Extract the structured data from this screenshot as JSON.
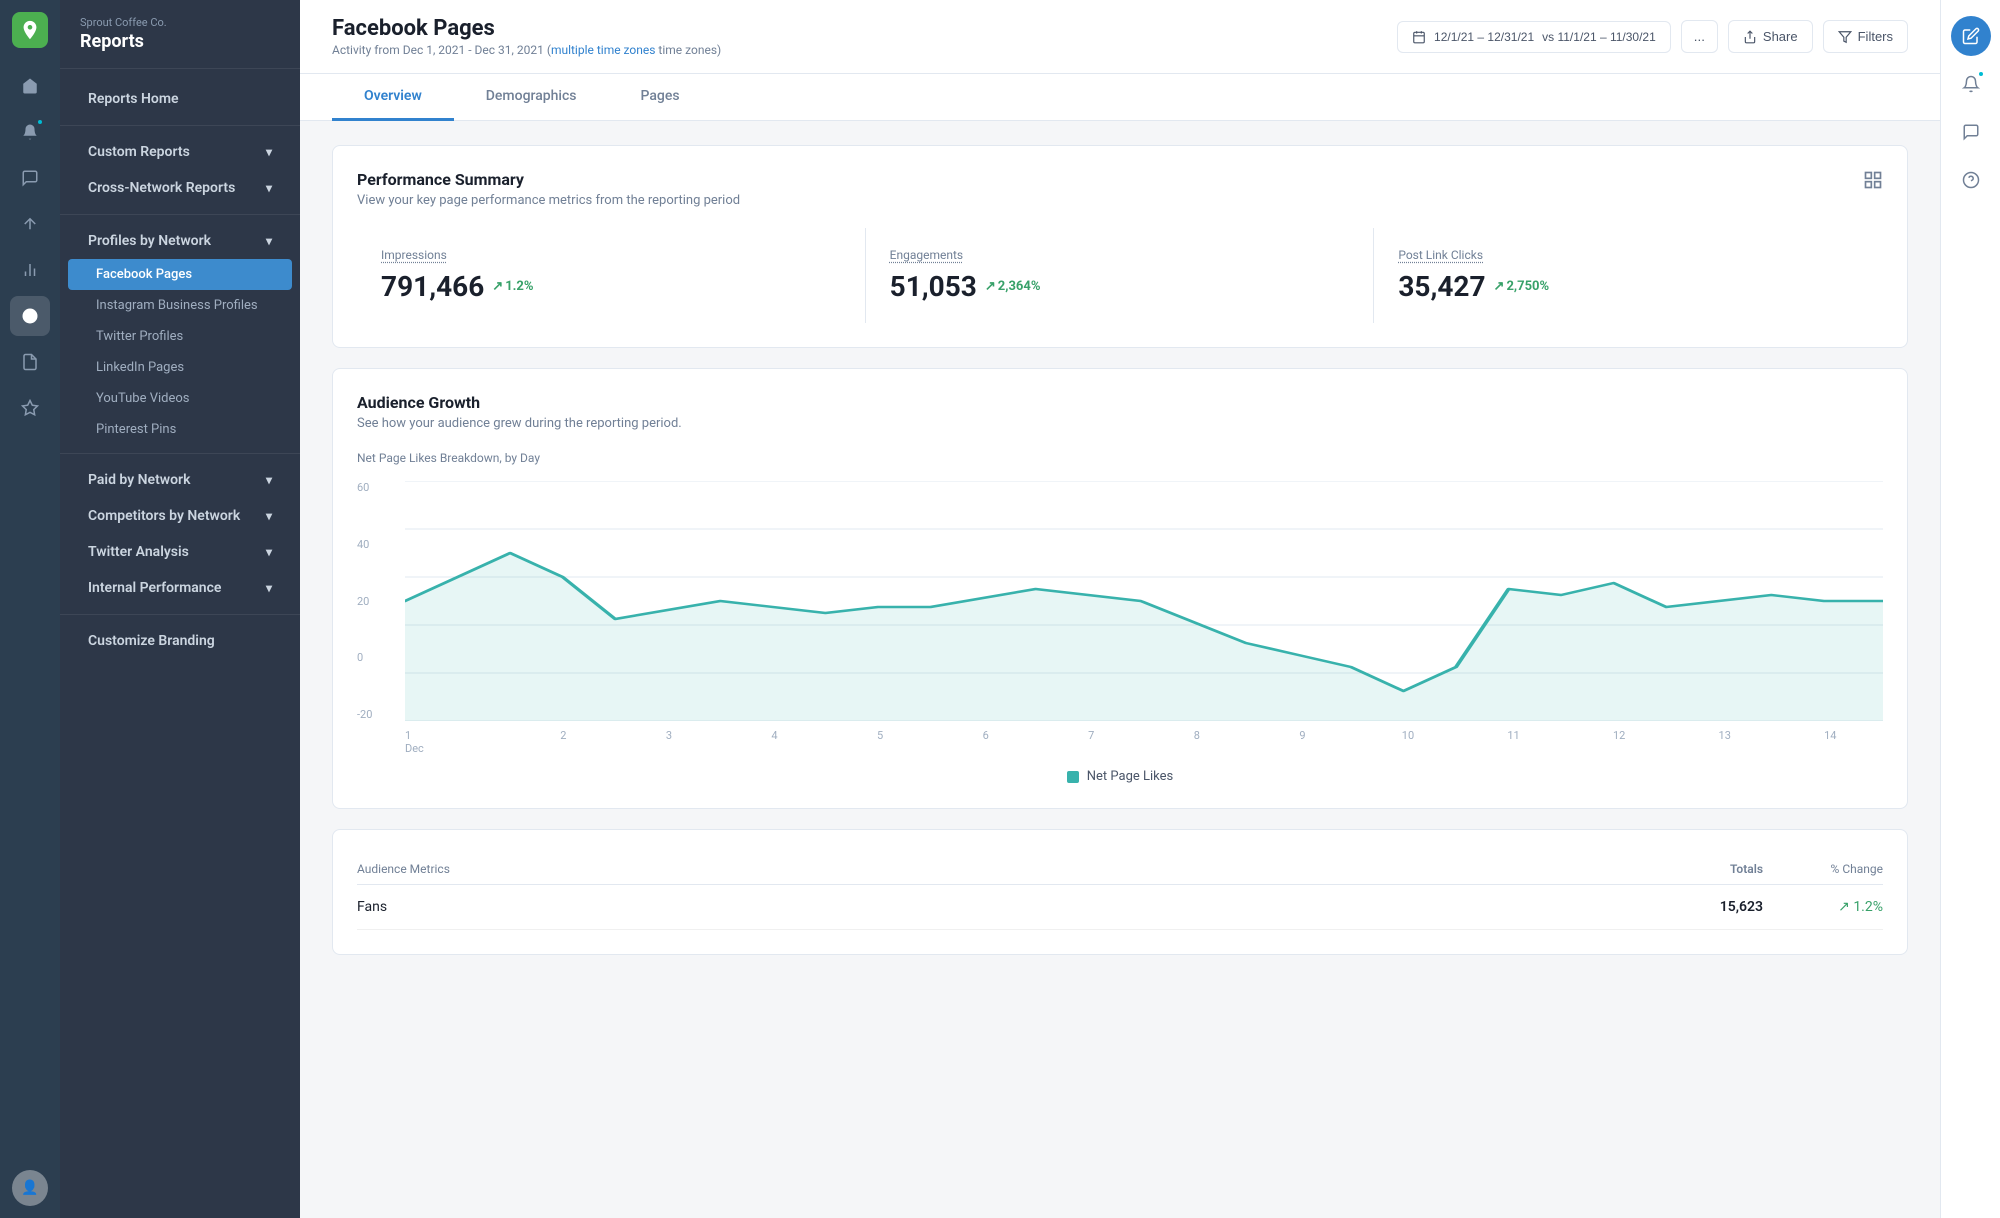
{
  "company": "Sprout Coffee Co.",
  "app": "Reports",
  "page": {
    "title": "Facebook Pages",
    "activity": "Activity from Dec 1, 2021 - Dec 31, 2021",
    "timezone_link": "multiple time zones"
  },
  "date_range": {
    "current": "12/1/21 – 12/31/21",
    "vs": "vs 11/1/21 – 11/30/21"
  },
  "header_actions": {
    "more": "...",
    "share": "Share",
    "filters": "Filters"
  },
  "tabs": [
    {
      "label": "Overview",
      "active": true
    },
    {
      "label": "Demographics",
      "active": false
    },
    {
      "label": "Pages",
      "active": false
    }
  ],
  "performance_summary": {
    "title": "Performance Summary",
    "subtitle": "View your key page performance metrics from the reporting period",
    "metrics": [
      {
        "label": "Impressions",
        "value": "791,466",
        "change": "1.2%",
        "up": true
      },
      {
        "label": "Engagements",
        "value": "51,053",
        "change": "2,364%",
        "up": true
      },
      {
        "label": "Post Link Clicks",
        "value": "35,427",
        "change": "2,750%",
        "up": true
      }
    ]
  },
  "audience_growth": {
    "title": "Audience Growth",
    "subtitle": "See how your audience grew during the reporting period.",
    "chart_label": "Net Page Likes Breakdown, by Day",
    "y_labels": [
      "60",
      "40",
      "20",
      "0",
      "-20"
    ],
    "x_labels": [
      "1\nDec",
      "2",
      "3",
      "4",
      "5",
      "6",
      "7",
      "8",
      "9",
      "10",
      "11",
      "12",
      "13",
      "14"
    ],
    "legend": "Net Page Likes"
  },
  "audience_metrics": {
    "title": "Audience Metrics",
    "col_totals": "Totals",
    "col_change": "% Change",
    "rows": [
      {
        "name": "Fans",
        "total": "15,623",
        "change": "1.2%",
        "up": true
      }
    ]
  },
  "sidebar": {
    "reports_home": "Reports Home",
    "sections": [
      {
        "label": "Custom Reports",
        "expandable": true,
        "items": []
      },
      {
        "label": "Cross-Network Reports",
        "expandable": true,
        "items": []
      },
      {
        "label": "Profiles by Network",
        "expandable": true,
        "items": [
          {
            "label": "Facebook Pages",
            "active": true
          },
          {
            "label": "Instagram Business Profiles",
            "active": false
          },
          {
            "label": "Twitter Profiles",
            "active": false
          },
          {
            "label": "LinkedIn Pages",
            "active": false
          },
          {
            "label": "YouTube Videos",
            "active": false
          },
          {
            "label": "Pinterest Pins",
            "active": false
          }
        ]
      },
      {
        "label": "Paid by Network",
        "expandable": true,
        "items": []
      },
      {
        "label": "Competitors by Network",
        "expandable": true,
        "items": []
      },
      {
        "label": "Twitter Analysis",
        "expandable": true,
        "items": []
      },
      {
        "label": "Internal Performance",
        "expandable": true,
        "items": []
      }
    ],
    "customize": "Customize Branding"
  }
}
